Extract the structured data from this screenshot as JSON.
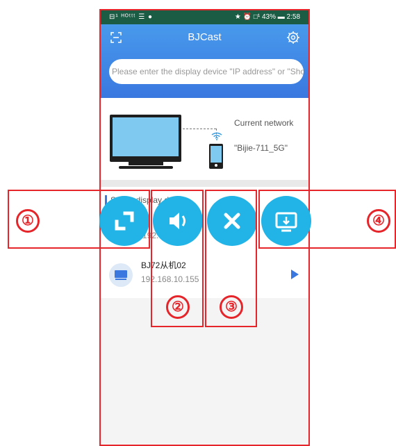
{
  "status_bar": {
    "left": "⊟¹ ᴴᴼᵗᵗᵗ ☰ ●",
    "right": "★ ⏰ □¹ 43% ▬ 2:58"
  },
  "header": {
    "title": "BJCast"
  },
  "search": {
    "placeholder": "Please enter the display device \"IP address\" or \"Short"
  },
  "network": {
    "label": "Current network",
    "name": "\"Bijie-711_5G\""
  },
  "device_list": {
    "section_label": "Select display d",
    "first_device_ip_partial": "192.",
    "second_device_ip_tail": "30",
    "device": {
      "name": "BJ72从机02",
      "ip": "192.168.10.155"
    }
  },
  "annotations": [
    "①",
    "②",
    "③",
    "④"
  ],
  "icons": [
    "expand-icon",
    "volume-icon",
    "close-icon",
    "cast-screen-icon"
  ],
  "colors": {
    "accent": "#3a78e0",
    "circle": "#22b4e6",
    "annotation": "#e5252a"
  }
}
